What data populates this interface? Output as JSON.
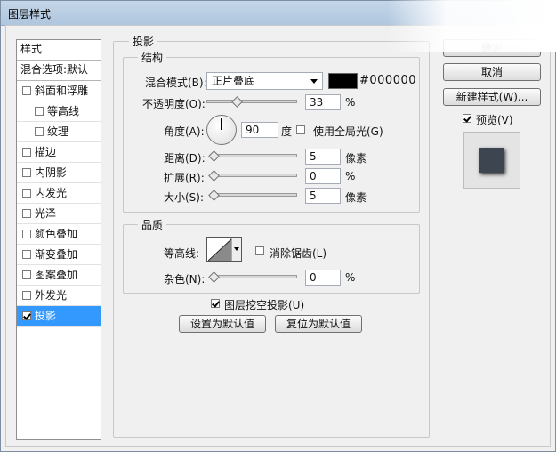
{
  "window": {
    "title": "图层样式"
  },
  "styles": {
    "header": "样式",
    "blend_options": "混合选项:默认",
    "items": [
      {
        "label": "斜面和浮雕",
        "checked": false,
        "sub": false,
        "selected": false
      },
      {
        "label": "等高线",
        "checked": false,
        "sub": true,
        "selected": false
      },
      {
        "label": "纹理",
        "checked": false,
        "sub": true,
        "selected": false
      },
      {
        "label": "描边",
        "checked": false,
        "sub": false,
        "selected": false
      },
      {
        "label": "内阴影",
        "checked": false,
        "sub": false,
        "selected": false
      },
      {
        "label": "内发光",
        "checked": false,
        "sub": false,
        "selected": false
      },
      {
        "label": "光泽",
        "checked": false,
        "sub": false,
        "selected": false
      },
      {
        "label": "颜色叠加",
        "checked": false,
        "sub": false,
        "selected": false
      },
      {
        "label": "渐变叠加",
        "checked": false,
        "sub": false,
        "selected": false
      },
      {
        "label": "图案叠加",
        "checked": false,
        "sub": false,
        "selected": false
      },
      {
        "label": "外发光",
        "checked": false,
        "sub": false,
        "selected": false
      },
      {
        "label": "投影",
        "checked": true,
        "sub": false,
        "selected": true
      }
    ]
  },
  "drop_shadow": {
    "title": "投影",
    "structure": {
      "title": "结构",
      "blend_mode_label": "混合模式(B):",
      "blend_mode_value": "正片叠底",
      "color_hex": "#000000",
      "opacity_label": "不透明度(O):",
      "opacity_value": "33",
      "opacity_unit": "%",
      "opacity_fraction": 0.33,
      "angle_label": "角度(A):",
      "angle_value": "90",
      "angle_unit": "度",
      "global_light_label": "使用全局光(G)",
      "global_light_checked": false,
      "distance_label": "距离(D):",
      "distance_value": "5",
      "distance_unit": "像素",
      "spread_label": "扩展(R):",
      "spread_value": "0",
      "spread_unit": "%",
      "size_label": "大小(S):",
      "size_value": "5",
      "size_unit": "像素"
    },
    "quality": {
      "title": "品质",
      "contour_label": "等高线:",
      "anti_alias_label": "消除锯齿(L)",
      "anti_alias_checked": false,
      "noise_label": "杂色(N):",
      "noise_value": "0",
      "noise_unit": "%"
    },
    "knockout_label": "图层挖空投影(U)",
    "knockout_checked": true,
    "make_default": "设置为默认值",
    "reset_default": "复位为默认值"
  },
  "actions": {
    "ok": "确定",
    "cancel": "取消",
    "new_style": "新建样式(W)...",
    "preview_label": "预览(V)",
    "preview_checked": true
  }
}
